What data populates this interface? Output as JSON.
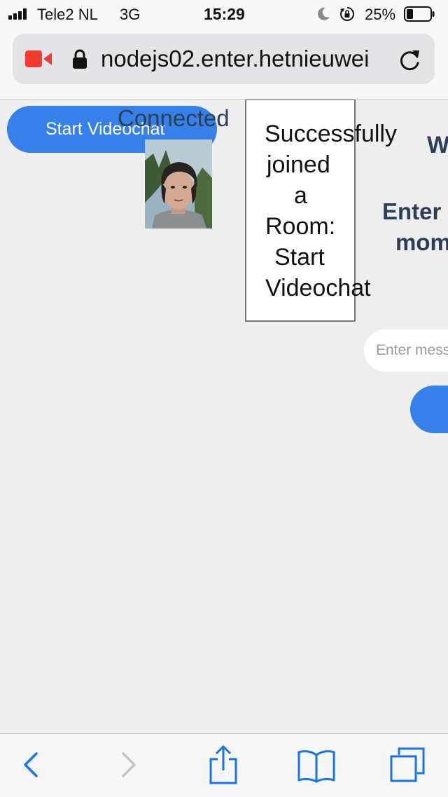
{
  "status_bar": {
    "carrier": "Tele2 NL",
    "network": "3G",
    "time": "15:29",
    "battery": "25%"
  },
  "browser": {
    "url": "nodejs02.enter.hetnieuwei",
    "icons": [
      "camera-recording-icon",
      "lock-icon",
      "reload-icon"
    ]
  },
  "page": {
    "start_button_label": "Start Videochat",
    "connected_label": "Connected",
    "status_lines": [
      "Successfully",
      "joined",
      "a",
      "Room:",
      "Start",
      "Videochat"
    ],
    "right_heading": "W",
    "right_subheading_line1": "Enter",
    "right_subheading_line2": "mom",
    "message_placeholder": "Enter mess"
  },
  "toolbar": {
    "icons": [
      "back-icon",
      "forward-icon",
      "share-icon",
      "bookmarks-icon",
      "tabs-icon"
    ]
  },
  "colors": {
    "accent": "#3680ea",
    "heading": "#2c3e55",
    "record_red": "#f23c32",
    "ios_blue": "#1a73e8"
  }
}
